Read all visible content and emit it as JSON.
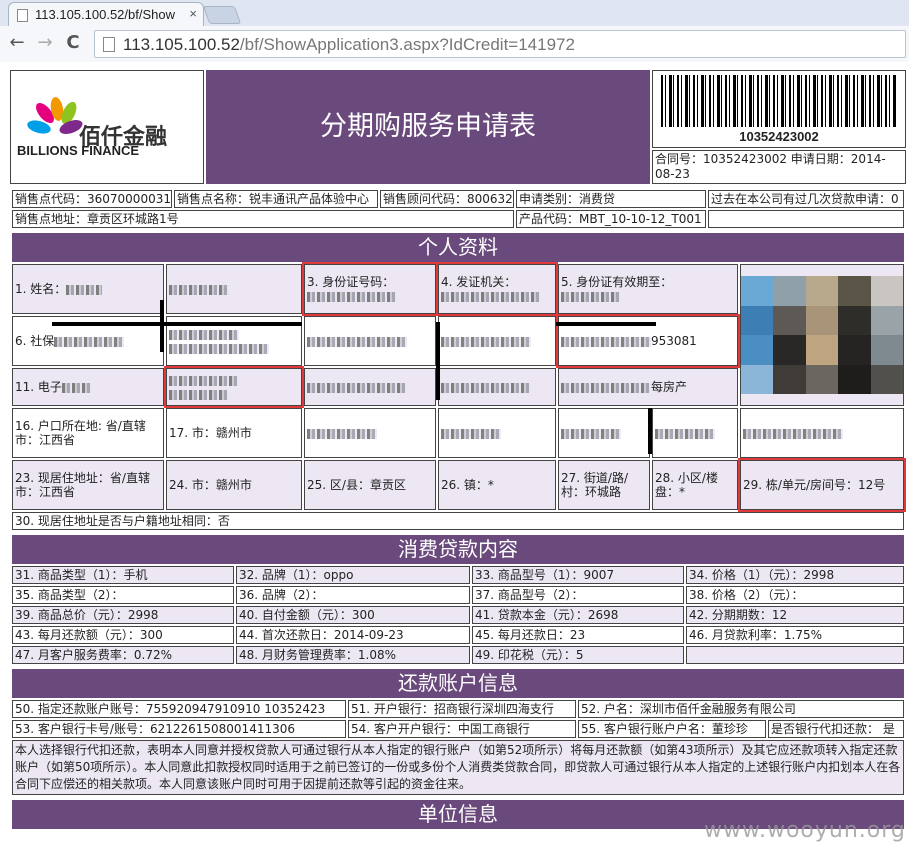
{
  "browser": {
    "tab_title": "113.105.100.52/bf/Show",
    "close_glyph": "×",
    "url_host": "113.105.100.52",
    "url_path": "/bf/ShowApplication3.aspx?IdCredit=141972",
    "back_glyph": "←",
    "forward_glyph": "→",
    "reload_glyph": "C"
  },
  "header": {
    "logo_zh": "佰仟金融",
    "logo_en": "BILLIONS FINANCE",
    "title": "分期购服务申请表",
    "barcode_number": "10352423002",
    "contract_info": "合同号：10352423002  申请日期：2014-08-23"
  },
  "store": {
    "code": "销售点代码：36070000031",
    "name": "销售点名称：锐丰通讯产品体验中心",
    "advisor": "销售顾问代码：800632",
    "category": "申请类别：消费贷",
    "past_loans": "过去在本公司有过几次贷款申请：0",
    "address": "销售点地址：章贡区环城路1号",
    "product_code": "产品代码：MBT_10-10-12_T001"
  },
  "sections": {
    "personal": "个人资料",
    "loan": "消费贷款内容",
    "repay": "还款账户信息",
    "employer": "单位信息"
  },
  "personal": {
    "r1": [
      "1. 姓名：",
      "",
      "3. 身份证号码：",
      "4. 发证机关：",
      "5. 身份证有效期至："
    ],
    "r2": [
      "6. 社保",
      "",
      "",
      "",
      "953081"
    ],
    "r3": [
      "11. 电子",
      "",
      "",
      "",
      "每房产"
    ],
    "r4": [
      "16. 户口所在地: 省/直辖市：江西省",
      "17. 市：赣州市",
      "",
      "",
      "",
      ""
    ],
    "r5": [
      "23. 现居住地址：省/直辖市：江西省",
      "24. 市：赣州市",
      "25. 区/县：章贡区",
      "26. 镇：*",
      "27. 街道/路/村：环城路",
      "28. 小区/楼盘：*",
      "29. 栋/单元/房间号：12号"
    ],
    "r6": "30. 现居住地址是否与户籍地址相同：否"
  },
  "loan": [
    [
      "31. 商品类型（1）：手机",
      "32. 品牌（1）：oppo",
      "33. 商品型号（1）：9007",
      "34. 价格（1）（元）：2998"
    ],
    [
      "35. 商品类型（2）：",
      "36. 品牌（2）：",
      "37. 商品型号（2）：",
      "38. 价格（2）（元）："
    ],
    [
      "39. 商品总价（元）：2998",
      "40. 自付金额（元）：300",
      "41. 贷款本金（元）：2698",
      "42. 分期期数：12"
    ],
    [
      "43. 每月还款额（元）：300",
      "44. 首次还款日：2014-09-23",
      "45. 每月还款日：23",
      "46. 月贷款利率：1.75%"
    ],
    [
      "47. 月客户服务费率：0.72%",
      "48. 月财务管理费率：1.08%",
      "49. 印花税（元）：5",
      ""
    ]
  ],
  "repay": {
    "r1": [
      "50. 指定还款账户账号：755920947910910  10352423",
      "51. 开户银行：招商银行深圳四海支行",
      "52. 户名：深圳市佰仟金融服务有限公司"
    ],
    "r2": [
      "53. 客户银行卡号/账号：6212261508001411306",
      "54. 客户开户银行：中国工商银行",
      "55. 客户银行账户户名：董珍珍",
      "是否银行代扣还款： 是"
    ],
    "note": "本人选择银行代扣还款，表明本人同意并授权贷款人可通过银行从本人指定的银行账户（如第52项所示）将每月还款额（如第43项所示）及其它应还款项转入指定还款账户（如第50项所示）。本人同意此扣款授权同时适用于之前已签订的一份或多份个人消费类贷款合同，即贷款人可通过银行从本人指定的上述银行账户内扣划本人在各合同下应偿还的相关款项。本人同意该账户同时可用于因提前还款等引起的资金往来。"
  },
  "watermark": "www.wooyun.org",
  "colors": {
    "band": "#6a4a7c",
    "lavender": "#ece7f2",
    "highlight": "#e23a3a"
  }
}
